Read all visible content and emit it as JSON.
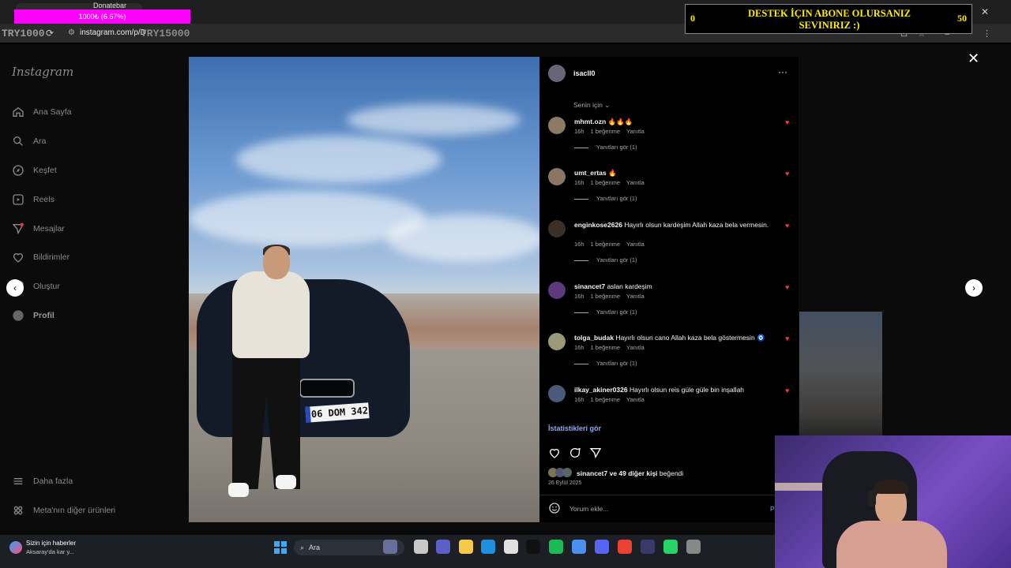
{
  "browser": {
    "url": "instagram.com/p/D",
    "overlay_left": "TRY1000",
    "overlay_url": "TRY15000",
    "overlay_progress": "1000₺ (6.67%)",
    "overlay_label": "Donatebar",
    "reload_icon": "reload-icon"
  },
  "donation": {
    "left": "0",
    "right": "50",
    "text": "DESTEK İÇIN ABONE OLURSANIZ SEVINIRIZ :)",
    "progress_fraction": 0.0
  },
  "sidebar": {
    "logo": "Instagram",
    "items": [
      {
        "label": "Ana Sayfa",
        "icon": "home-icon"
      },
      {
        "label": "Ara",
        "icon": "search-icon"
      },
      {
        "label": "Keşfet",
        "icon": "compass-icon"
      },
      {
        "label": "Reels",
        "icon": "reels-icon"
      },
      {
        "label": "Mesajlar",
        "icon": "messages-icon"
      },
      {
        "label": "Bildirimler",
        "icon": "heart-icon"
      },
      {
        "label": "Oluştur",
        "icon": "plus-icon"
      },
      {
        "label": "Profil",
        "icon": "profile-icon"
      }
    ],
    "bottom": [
      {
        "label": "Daha fazla",
        "icon": "menu-icon"
      },
      {
        "label": "Meta'nın diğer ürünleri",
        "icon": "meta-icon"
      }
    ]
  },
  "photo": {
    "plate": "06 DOM 342"
  },
  "post": {
    "author": "isacll0",
    "more": "···",
    "sort_label": "Senin için",
    "comments": [
      {
        "user": "mhmt.ozn",
        "text": "🔥🔥🔥",
        "time": "16h",
        "likes": "1 beğenme",
        "reply": "Yanıtla",
        "replies": "Yanıtları gör (1)"
      },
      {
        "user": "umt_ertas",
        "text": "🔥",
        "time": "16h",
        "likes": "1 beğenme",
        "reply": "Yanıtla",
        "replies": "Yanıtları gör (1)"
      },
      {
        "user": "enginkose2626",
        "text": "Hayırlı olsun kardeşim Allah kaza bela vermesin.",
        "time": "16h",
        "likes": "1 beğenme",
        "reply": "Yanıtla",
        "replies": "Yanıtları gör (1)"
      },
      {
        "user": "sinancet7",
        "text": "aslan kardeşim",
        "time": "16h",
        "likes": "1 beğenme",
        "reply": "Yanıtla",
        "replies": "Yanıtları gör (1)"
      },
      {
        "user": "tolga_budak",
        "text": "Hayırlı olsun cano Allah kaza bela göstermesin 🧿",
        "time": "16h",
        "likes": "1 beğenme",
        "reply": "Yanıtla",
        "replies": "Yanıtları gör (1)"
      },
      {
        "user": "ilkay_akiner0326",
        "text": "Hayırlı olsun reis güle güle bin inşallah",
        "time": "16h",
        "likes": "1 beğenme",
        "reply": "Yanıtla",
        "replies": ""
      }
    ],
    "stats": "İstatistikleri gör",
    "likes_user": "sinancet7",
    "likes_rest": "ve 49 diğer kişi",
    "likes_suffix": "beğendi",
    "date": "26 Eylül 2025",
    "comment_placeholder": "Yorum ekle...",
    "post_label": "P"
  },
  "taskbar": {
    "news_title": "Sizin için haberler",
    "news_sub": "Aksaray'da kar y...",
    "search_label": "Ara",
    "apps": [
      "windows-icon",
      "file-explorer-icon",
      "teams-icon",
      "folder-icon",
      "edge-icon",
      "store-icon",
      "tiktok-icon",
      "spotify-icon",
      "app-icon",
      "discord-icon",
      "chrome-icon",
      "obs-icon",
      "whatsapp-icon",
      "settings-icon",
      "red-app-icon"
    ]
  },
  "colors": {
    "accent_link": "#8aa8ff",
    "heart": "#ff3040",
    "donation_text": "#ffee00",
    "overlay": "#ff00ff"
  }
}
